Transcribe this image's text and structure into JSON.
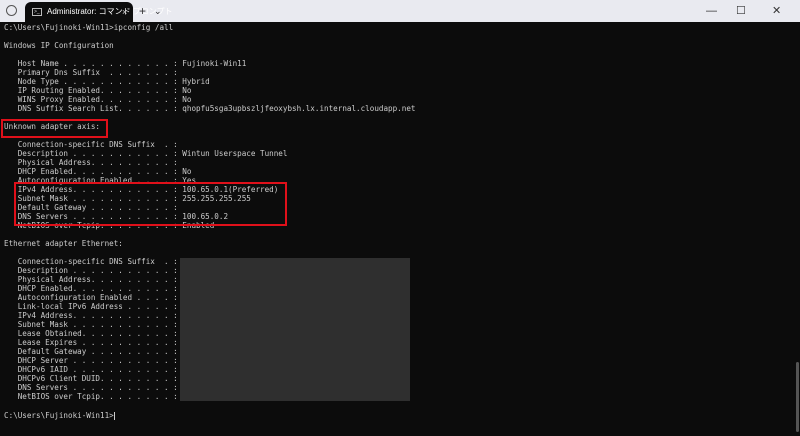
{
  "window": {
    "tab_title": "Administrator: コマンド プロンプト",
    "tab_close": "×",
    "tab_icon_text": ">_",
    "new_tab": "+",
    "dropdown": "⌄",
    "minimize": "—",
    "maximize": "☐",
    "close": "✕"
  },
  "terminal": {
    "lines": [
      "C:\\Users\\Fujinoki-Win11>ipconfig /all",
      "Windows IP Configuration",
      "   Host Name . . . . . . . . . . . . : Fujinoki-Win11",
      "   Primary Dns Suffix  . . . . . . . :",
      "   Node Type . . . . . . . . . . . . : Hybrid",
      "   IP Routing Enabled. . . . . . . . : No",
      "   WINS Proxy Enabled. . . . . . . . : No",
      "   DNS Suffix Search List. . . . . . : qhopfu5sga3upbszljfeoxybsh.lx.internal.cloudapp.net",
      "Unknown adapter axis:",
      "   Connection-specific DNS Suffix  . :",
      "   Description . . . . . . . . . . . : Wintun Userspace Tunnel",
      "   Physical Address. . . . . . . . . :",
      "   DHCP Enabled. . . . . . . . . . . : No",
      "   Autoconfiguration Enabled . . . . : Yes",
      "   IPv4 Address. . . . . . . . . . . : 100.65.0.1(Preferred)",
      "   Subnet Mask . . . . . . . . . . . : 255.255.255.255",
      "   Default Gateway . . . . . . . . . :",
      "   DNS Servers . . . . . . . . . . . : 100.65.0.2",
      "   NetBIOS over Tcpip. . . . . . . . : Enabled",
      "Ethernet adapter Ethernet:",
      "   Connection-specific DNS Suffix  . :",
      "   Description . . . . . . . . . . . :",
      "   Physical Address. . . . . . . . . :",
      "   DHCP Enabled. . . . . . . . . . . :",
      "   Autoconfiguration Enabled . . . . :",
      "   Link-local IPv6 Address . . . . . :",
      "   IPv4 Address. . . . . . . . . . . :",
      "   Subnet Mask . . . . . . . . . . . :",
      "   Lease Obtained. . . . . . . . . . :",
      "   Lease Expires . . . . . . . . . . :",
      "   Default Gateway . . . . . . . . . :",
      "   DHCP Server . . . . . . . . . . . :",
      "   DHCPv6 IAID . . . . . . . . . . . :",
      "   DHCPv6 Client DUID. . . . . . . . :",
      "   DNS Servers . . . . . . . . . . . :",
      "   NetBIOS over Tcpip. . . . . . . . :",
      "C:\\Users\\Fujinoki-Win11>"
    ]
  },
  "colors": {
    "terminal_bg": "#0c0c0c",
    "text": "#cccccc",
    "highlight": "#e0101a",
    "redaction": "#2f2f2f"
  }
}
